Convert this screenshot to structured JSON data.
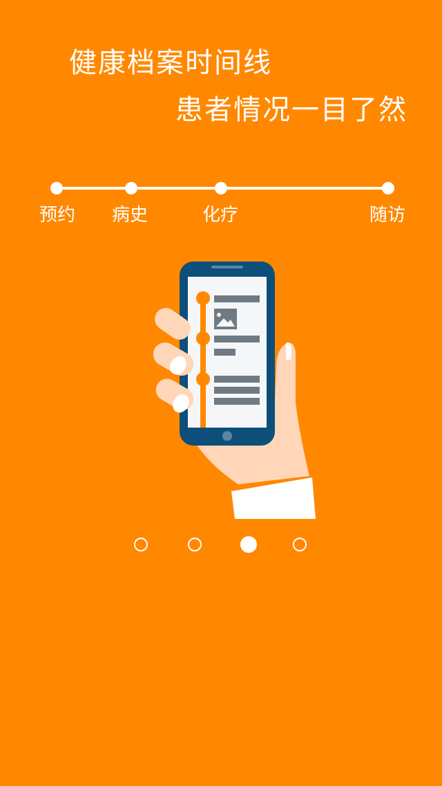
{
  "header": {
    "title": "健康档案时间线",
    "subtitle": "患者情况一目了然"
  },
  "timeline": {
    "steps": [
      {
        "label": "预约"
      },
      {
        "label": "病史"
      },
      {
        "label": "化疗"
      },
      {
        "label": "随访"
      }
    ]
  },
  "illustration": {
    "icon": "hand-holding-phone-icon"
  },
  "pager": {
    "total": 4,
    "active_index": 2
  },
  "colors": {
    "background": "#FF8800",
    "phone_body": "#0D4F7A",
    "screen": "#F5F6F7",
    "accent": "#FF8800",
    "skin": "#FFD6B8",
    "content_bars": "#6F7A83"
  }
}
